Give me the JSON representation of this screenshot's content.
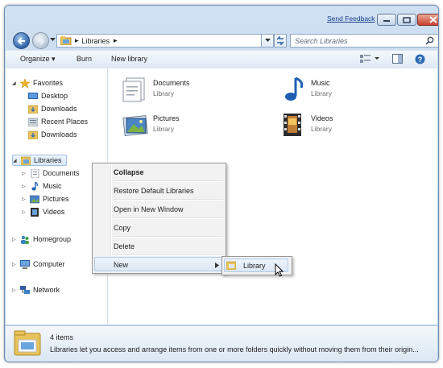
{
  "titlebar": {
    "send_feedback": "Send Feedback"
  },
  "nav": {
    "breadcrumb_root": "▸",
    "breadcrumb_current": "Libraries",
    "breadcrumb_sep": "▸"
  },
  "search": {
    "placeholder": "Search Libraries"
  },
  "toolbar": {
    "organize": "Organize",
    "burn": "Burn",
    "new_library": "New library"
  },
  "navpane": {
    "favorites": "Favorites",
    "fav_items": [
      "Desktop",
      "Downloads",
      "Recent Places",
      "Downloads"
    ],
    "libraries": "Libraries",
    "lib_items": [
      "Documents",
      "Music",
      "Pictures",
      "Videos"
    ],
    "homegroup": "Homegroup",
    "computer": "Computer",
    "network": "Network"
  },
  "content": {
    "items": [
      {
        "name": "Documents",
        "type": "Library",
        "icon": "documents-library-icon"
      },
      {
        "name": "Music",
        "type": "Library",
        "icon": "music-library-icon"
      },
      {
        "name": "Pictures",
        "type": "Library",
        "icon": "pictures-library-icon"
      },
      {
        "name": "Videos",
        "type": "Library",
        "icon": "videos-library-icon"
      }
    ]
  },
  "context_menu": {
    "collapse": "Collapse",
    "restore": "Restore Default Libraries",
    "open_new": "Open in New Window",
    "copy": "Copy",
    "delete": "Delete",
    "new": "New"
  },
  "submenu": {
    "library": "Library"
  },
  "details": {
    "count": "4 items",
    "description": "Libraries let you access and arrange items from one or more folders quickly without moving them from their origin..."
  },
  "colors": {
    "accent": "#3a6ea5",
    "selection": "#d9e8f8",
    "folder": "#f2c94c"
  }
}
